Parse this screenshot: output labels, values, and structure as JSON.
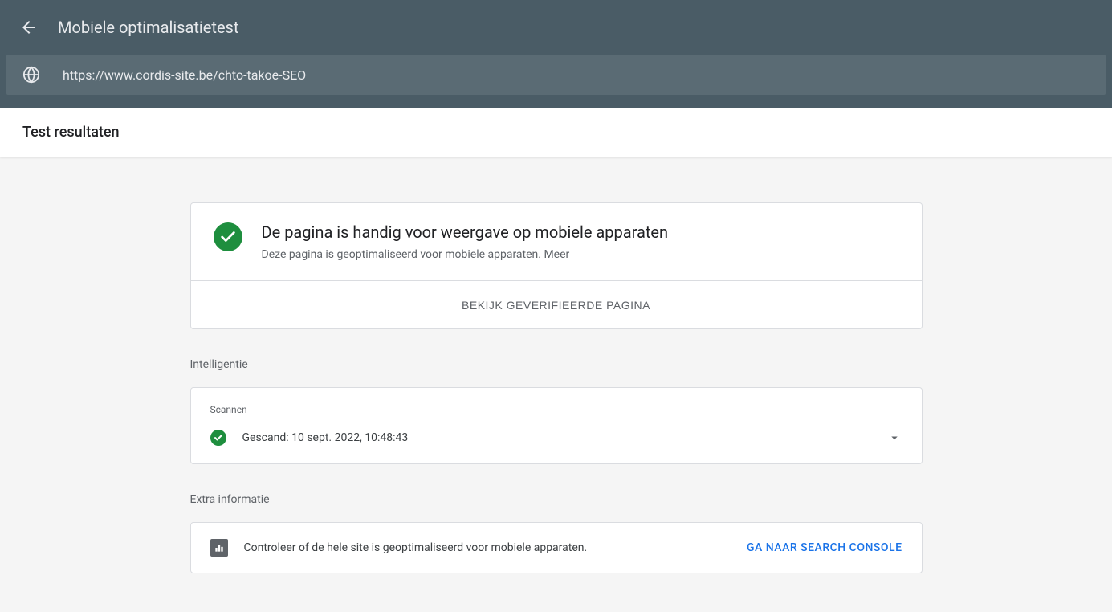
{
  "header": {
    "title": "Mobiele optimalisatietest",
    "url": "https://www.cordis-site.be/chto-takoe-SEO"
  },
  "tabs": {
    "results_label": "Test resultaten"
  },
  "result": {
    "title": "De pagina is handig voor weergave op mobiele apparaten",
    "subtitle": "Deze pagina is geoptimaliseerd voor mobiele apparaten. ",
    "more_label": "Meer",
    "view_verified_label": "BEKIJK GEVERIFIEERDE PAGINA"
  },
  "intelligence": {
    "section_label": "Intelligentie",
    "scan_label": "Scannen",
    "scan_text": "Gescand: 10 sept. 2022, 10:48:43"
  },
  "extra": {
    "section_label": "Extra informatie",
    "text": "Controleer of de hele site is geoptimaliseerd voor mobiele apparaten.",
    "action_label": "GA NAAR SEARCH CONSOLE"
  }
}
